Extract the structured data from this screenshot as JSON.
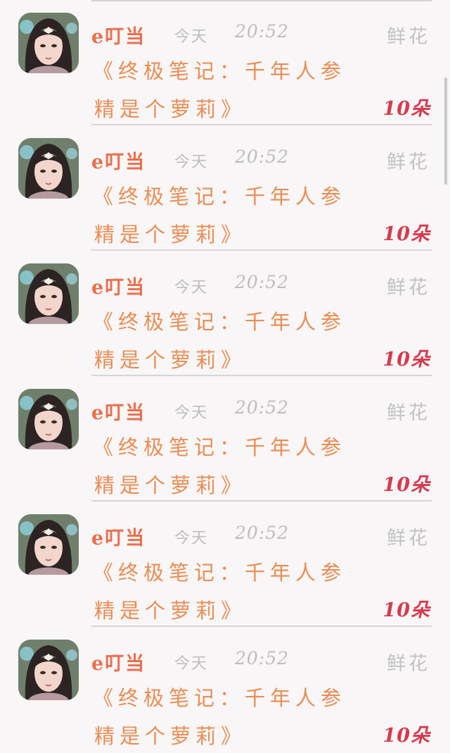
{
  "messages": [
    {
      "user": "e叮当",
      "day": "今天",
      "time": "20:52",
      "gift": "鲜花",
      "line1": "《终极笔记：千年人参",
      "line2": "精是个萝莉》",
      "count": "10朵"
    },
    {
      "user": "e叮当",
      "day": "今天",
      "time": "20:52",
      "gift": "鲜花",
      "line1": "《终极笔记：千年人参",
      "line2": "精是个萝莉》",
      "count": "10朵"
    },
    {
      "user": "e叮当",
      "day": "今天",
      "time": "20:52",
      "gift": "鲜花",
      "line1": "《终极笔记：千年人参",
      "line2": "精是个萝莉》",
      "count": "10朵"
    },
    {
      "user": "e叮当",
      "day": "今天",
      "time": "20:52",
      "gift": "鲜花",
      "line1": "《终极笔记：千年人参",
      "line2": "精是个萝莉》",
      "count": "10朵"
    },
    {
      "user": "e叮当",
      "day": "今天",
      "time": "20:52",
      "gift": "鲜花",
      "line1": "《终极笔记：千年人参",
      "line2": "精是个萝莉》",
      "count": "10朵"
    },
    {
      "user": "e叮当",
      "day": "今天",
      "time": "20:52",
      "gift": "鲜花",
      "line1": "《终极笔记：千年人参",
      "line2": "精是个萝莉》",
      "count": "10朵"
    }
  ],
  "icons": {
    "avatar": "avatar-portrait-icon"
  },
  "colors": {
    "username": "#eb6f4d",
    "message": "#ea8d55",
    "count": "#d73a4d",
    "muted": "#bdbdbd",
    "background": "#f8f6f6"
  }
}
